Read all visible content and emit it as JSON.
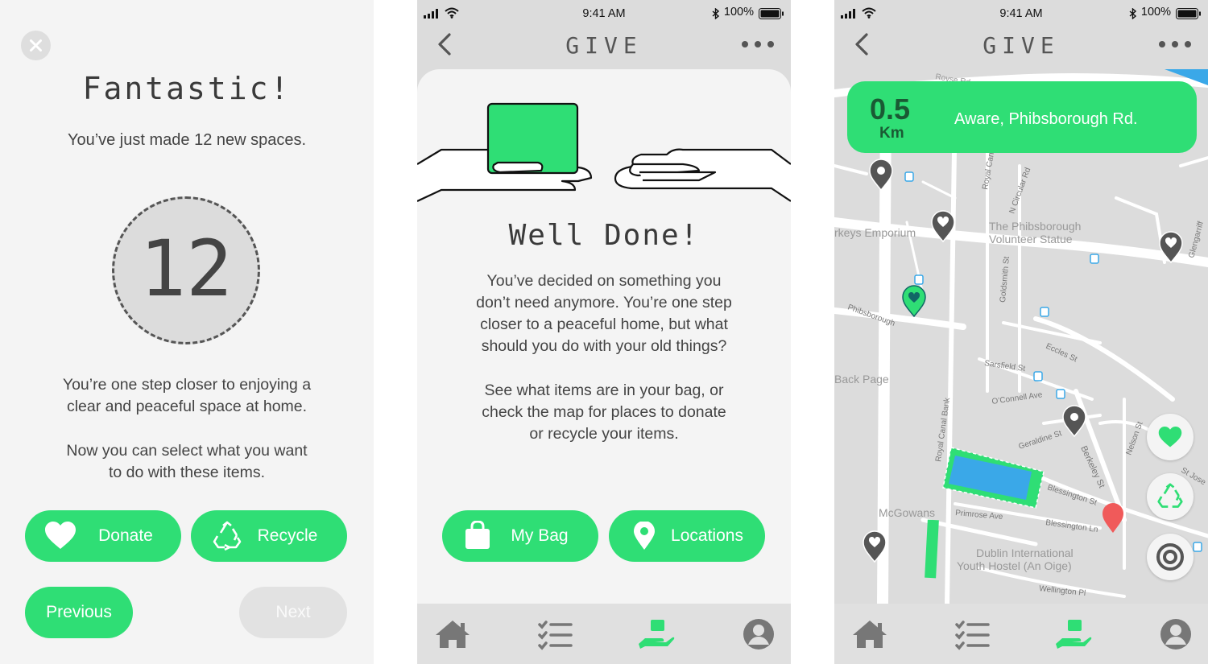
{
  "screen1": {
    "title": "Fantastic!",
    "subtitle": "You’ve just made 12 new spaces.",
    "count": "12",
    "para1_line1": "You’re one step closer to enjoying a",
    "para1_line2": "clear and peaceful space at home.",
    "para2_line1": "Now you can select what you want",
    "para2_line2": "to do with these items.",
    "donate_label": "Donate",
    "recycle_label": "Recycle",
    "previous_label": "Previous",
    "next_label": "Next"
  },
  "status": {
    "time": "9:41 AM",
    "battery": "100%"
  },
  "header": {
    "title": "GIVE"
  },
  "screen2": {
    "heading": "Well Done!",
    "p1": [
      "You’ve decided on something you",
      "don’t need anymore. You’re one step",
      "closer to a peaceful home, but what",
      "should you do with your old things?"
    ],
    "p2": [
      "See what items are in your bag, or",
      "check the map for places to donate",
      "or recycle your items."
    ],
    "mybag_label": "My Bag",
    "locations_label": "Locations"
  },
  "screen3": {
    "distance_value": "0.5",
    "distance_unit": "Km",
    "destination": "Aware, Phibsborough Rd.",
    "map_labels": {
      "royse": "Royse Rd",
      "royal_canal": "Royal Canal",
      "n_circular": "N Circular Rd",
      "emporium": "rkeys Emporium",
      "statue1": "The Phibsborough",
      "statue2": "Volunteer Statue",
      "glengarriff": "Glengarriff",
      "goldsmith": "Goldsmith St",
      "phibsborough": "Phibsborough",
      "eccles": "Eccles St",
      "sarsfield": "Sarsfield St",
      "backpage": "Back Page",
      "oconnell": "O’Connell Ave",
      "royal_canal_bank": "Royal Canal Bank",
      "geraldine": "Geraldine St",
      "nelson": "Nelson St",
      "berkeley": "Berkeley St",
      "stjos": "St Jose",
      "blessington": "Blessington St",
      "blessington_ln": "Blessington Ln",
      "mcgowans": "McGowans",
      "primrose": "Primrose Ave",
      "hostel1": "Dublin International",
      "hostel2": "Youth Hostel (An Oige)",
      "wellington": "Wellington Pl"
    }
  },
  "colors": {
    "accent": "#2fde75",
    "pin": "#555555",
    "destination": "#f05a5a",
    "water": "#3aa8e8"
  },
  "tabs": [
    "home-icon",
    "checklist-icon",
    "give-hand-icon",
    "profile-icon"
  ]
}
